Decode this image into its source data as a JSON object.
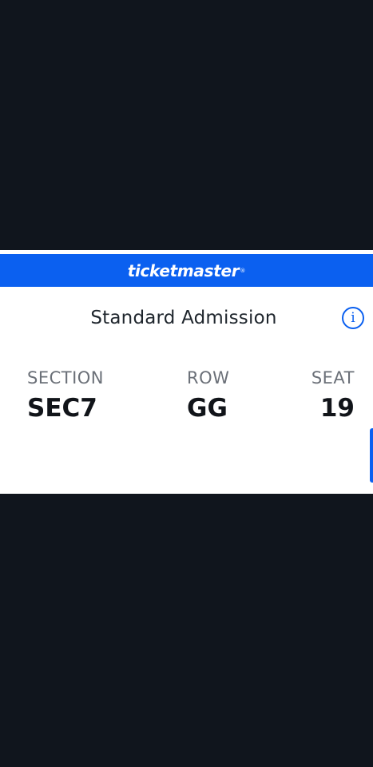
{
  "brand": {
    "name": "ticketmaster",
    "reg_mark": "®",
    "color": "#0b60f0"
  },
  "ticket": {
    "admission_title": "Standard Admission",
    "info_icon": "info-icon",
    "section_label": "SECTION",
    "section_value": "SEC7",
    "row_label": "ROW",
    "row_value": "GG",
    "seat_label": "SEAT",
    "seat_value": "19"
  },
  "colors": {
    "background": "#10151d",
    "card": "#ffffff",
    "accent": "#0b60f0"
  }
}
